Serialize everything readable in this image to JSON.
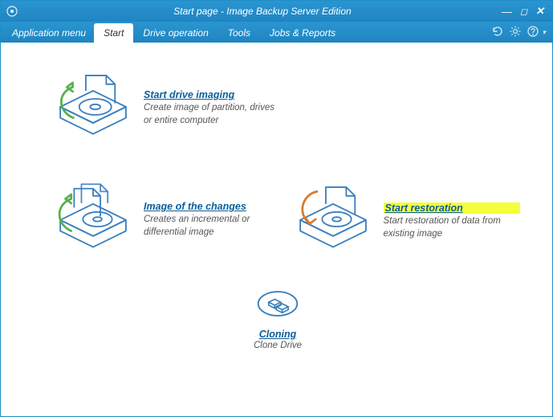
{
  "window": {
    "title": "Start page - Image Backup Server Edition"
  },
  "menubar": {
    "app_menu": "Application menu",
    "tabs": [
      {
        "label": "Start",
        "active": true
      },
      {
        "label": "Drive operation"
      },
      {
        "label": "Tools"
      },
      {
        "label": "Jobs & Reports"
      }
    ]
  },
  "tiles": {
    "imaging": {
      "title": "Start drive imaging",
      "desc": "Create image of partition, drives or entire computer"
    },
    "changes": {
      "title": "Image of the changes",
      "desc": "Creates an incremental or differential image"
    },
    "restore": {
      "title": "Start restoration",
      "desc": "Start restoration of data from existing image"
    },
    "cloning": {
      "title": "Cloning",
      "desc": "Clone Drive"
    }
  },
  "colors": {
    "blue": "#2a95d0",
    "link": "#0b5f99",
    "stroke": "#3a7fbe",
    "green": "#55b24b",
    "orange": "#d47b2e",
    "highlight": "#f4ff3a"
  }
}
